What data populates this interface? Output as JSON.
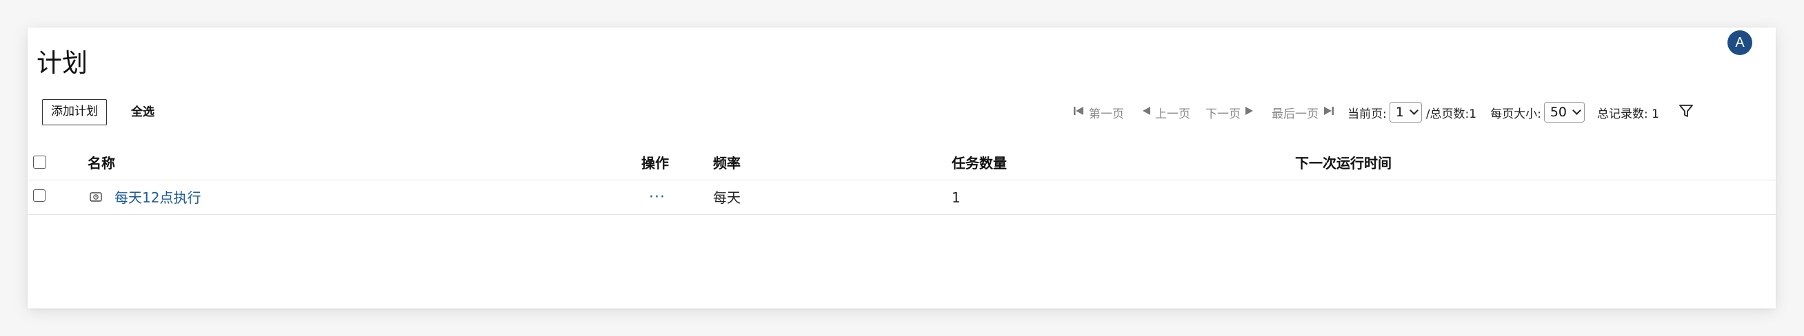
{
  "header": {
    "title": "计划",
    "avatar_initial": "A"
  },
  "toolbar": {
    "add_label": "添加计划",
    "select_all_label": "全选"
  },
  "pager": {
    "first_label": "第一页",
    "prev_label": "上一页",
    "next_label": "下一页",
    "last_label": "最后一页",
    "current_page_label": "当前页:",
    "current_page": "1",
    "total_pages_label": "/总页数:1",
    "page_size_label": "每页大小:",
    "page_size": "50",
    "total_records_label": "总记录数: 1"
  },
  "table": {
    "columns": {
      "name": "名称",
      "actions": "操作",
      "frequency": "频率",
      "task_count": "任务数量",
      "next_run": "下一次运行时间"
    },
    "rows": [
      {
        "name": "每天12点执行",
        "actions": "···",
        "frequency": "每天",
        "task_count": "1",
        "next_run": ""
      }
    ]
  },
  "icons": {
    "first_page": "skip-first-icon",
    "prev_page": "triangle-left-icon",
    "next_page": "triangle-right-icon",
    "last_page": "skip-last-icon",
    "filter": "funnel-icon",
    "row_type": "schedule-icon"
  },
  "colors": {
    "accent": "#1d4d84",
    "link": "#1a5a9a",
    "muted": "#888888"
  }
}
